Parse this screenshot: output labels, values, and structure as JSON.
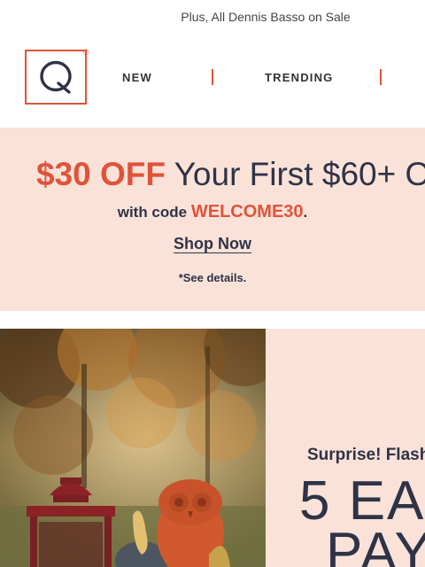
{
  "preheader": {
    "text": "Plus, All Dennis Basso on Sale"
  },
  "nav": {
    "items": [
      {
        "label": "NEW"
      },
      {
        "label": "TRENDING"
      }
    ]
  },
  "promo": {
    "amount": "$30 OFF",
    "headline_rest": "Your First $60+ O",
    "code_prefix": "with code",
    "code": "WELCOME30",
    "code_suffix": ".",
    "cta": "Shop Now",
    "details": "*See details."
  },
  "hero": {
    "kicker": "Surprise! Flash",
    "headline_line1": "5 EA",
    "headline_line2": "PAY"
  },
  "colors": {
    "accent": "#e0533a",
    "navy": "#2e3346",
    "promo_bg": "#fbe2d9"
  }
}
